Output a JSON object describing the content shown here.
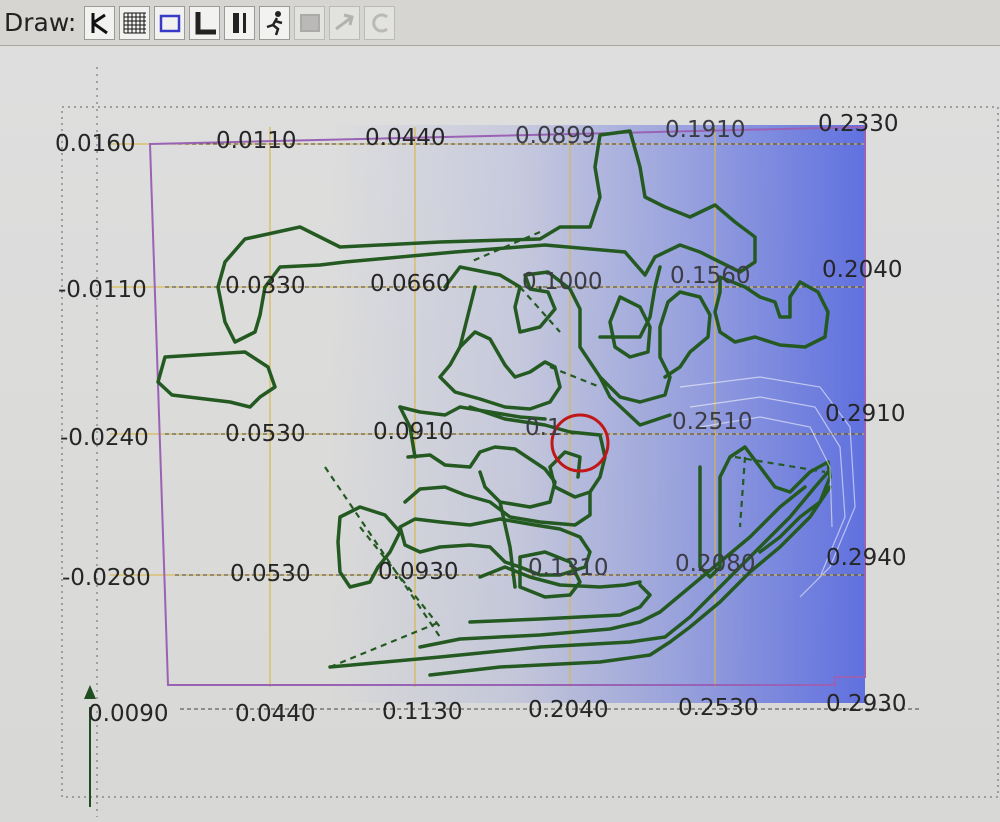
{
  "toolbar": {
    "label": "Draw:",
    "tools": [
      {
        "name": "pointer-tool-button",
        "icon": "cursor-k-icon",
        "enabled": true
      },
      {
        "name": "grid-tool-button",
        "icon": "grid-icon",
        "enabled": true
      },
      {
        "name": "rectangle-tool-button",
        "icon": "rectangle-icon",
        "enabled": true
      },
      {
        "name": "angle-tool-button",
        "icon": "angle-line-icon",
        "enabled": true
      },
      {
        "name": "line-tool-button",
        "icon": "bar-line-icon",
        "enabled": true
      },
      {
        "name": "route-tool-button",
        "icon": "route-runner-icon",
        "enabled": true
      },
      {
        "name": "fill-tool-button",
        "icon": "filled-rect-icon",
        "enabled": false
      },
      {
        "name": "arrow-tool-button",
        "icon": "arrow-icon",
        "enabled": false
      },
      {
        "name": "arc-tool-button",
        "icon": "arc-icon",
        "enabled": false
      }
    ]
  },
  "grid_labels": {
    "row1": [
      "0.0160",
      "0.0110",
      "0.0440",
      "0.0899",
      "0.1910",
      "0.2330"
    ],
    "row2": [
      "-0.0110",
      "0.0330",
      "0.0660",
      "0.1000",
      "0.1560",
      "0.2040"
    ],
    "row3": [
      "-0.0240",
      "0.0530",
      "0.0910",
      "0.1",
      "0.2510",
      "0.2910"
    ],
    "row4": [
      "-0.0280",
      "0.0530",
      "0.0930",
      "0.1310",
      "0.2080",
      "0.2940"
    ],
    "row5": [
      "0.0090",
      "0.0440",
      "0.1130",
      "0.2040",
      "0.2530",
      "0.2930"
    ]
  },
  "colors": {
    "trace": "#245a22",
    "gridline": "#d8b84a",
    "board_outline": "#9a62b4",
    "selection_marker": "#c01818",
    "highlight": "#4a5ee0"
  }
}
